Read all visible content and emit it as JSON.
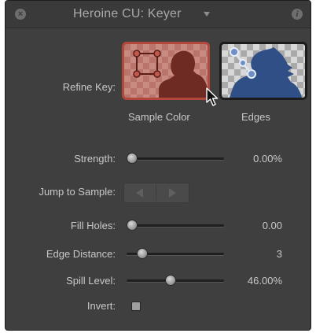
{
  "titlebar": {
    "title": "Heroine CU: Keyer",
    "close_icon": "close-icon",
    "menu_icon": "chevron-down-icon",
    "info_icon": "info-icon"
  },
  "refine_key": {
    "label": "Refine Key:",
    "options": [
      {
        "caption": "Sample Color",
        "icon": "sample-color-icon",
        "selected": true
      },
      {
        "caption": "Edges",
        "icon": "edges-icon",
        "selected": false
      }
    ]
  },
  "strength": {
    "label": "Strength:",
    "value": "0.00%",
    "level": 0.0
  },
  "jump_to_sample": {
    "label": "Jump to Sample:",
    "prev_icon": "previous-icon",
    "next_icon": "next-icon"
  },
  "fill_holes": {
    "label": "Fill Holes:",
    "value": "0.00",
    "level": 0.0
  },
  "edge_distance": {
    "label": "Edge Distance:",
    "value": "3",
    "level": 0.1
  },
  "spill_level": {
    "label": "Spill Level:",
    "value": "46.00%",
    "level": 0.46
  },
  "invert": {
    "label": "Invert:",
    "checked": false
  },
  "colors": {
    "panel_bg": "#3f3f3f",
    "selected_outline": "#b0483b",
    "text": "#c8c8c8"
  }
}
